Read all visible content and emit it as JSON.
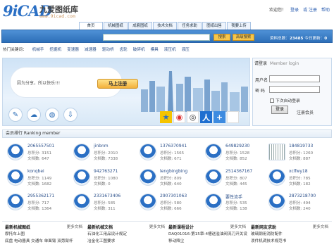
{
  "header": {
    "logo_mark": "9iCAD",
    "logo_name": "九爱图纸库",
    "logo_url": "www.9icad.com",
    "welcome": "欢迎您！",
    "login_link": "登录",
    "register_link": "或 注册",
    "help": "帮助"
  },
  "nav": {
    "tabs": [
      "首页",
      "机械图纸",
      "成套图纸",
      "技术文档",
      "任务求助",
      "图纸出售",
      "我要上传"
    ]
  },
  "search": {
    "search_button": "搜索",
    "advanced_button": "高级搜索",
    "stats_label": "资料总数：",
    "stats_value": "23485",
    "stats_sep": "今日更新：",
    "today_value": "0"
  },
  "hot": {
    "label": "热门关键词：",
    "keywords": [
      "机械手",
      "挖掘机",
      "变速器",
      "减速器",
      "驱动桥",
      "齿轮",
      "破碎机",
      "模具",
      "液压机",
      "液压"
    ]
  },
  "banner": {
    "slogan": "因为分享，所以快乐!!!",
    "register_button": "马上注册",
    "feature_icons": [
      "share-icon",
      "upload-icon",
      "globe-icon",
      "download-icon"
    ],
    "social_icons": [
      "star-icon",
      "weibo-icon",
      "qzone-icon",
      "people-icon",
      "plus-icon"
    ]
  },
  "login": {
    "title": "请登录",
    "subtitle": "Member login",
    "user_label": "用户名",
    "pass_label": "密  码",
    "remember": "下次自动登录",
    "login_button": "登录",
    "register_link": "注册会员"
  },
  "ranking": {
    "title": "会员排行 Ranking member",
    "members": [
      {
        "name": "2065557501",
        "score": "总积分: 3151",
        "docs": "文档数: 647"
      },
      {
        "name": "jinbnm",
        "score": "总积分: 2010",
        "docs": "文档数: 7338"
      },
      {
        "name": "1376370941",
        "score": "总积分: 1565",
        "docs": "文档数: 671"
      },
      {
        "name": "649829230",
        "score": "总积分: 1528",
        "docs": "文档数: 852"
      },
      {
        "name": "184819733",
        "score": "总积分: 1260",
        "docs": "文档数: 887"
      },
      {
        "name": "konqbei",
        "score": "总积分: 1149",
        "docs": "文档数: 1682"
      },
      {
        "name": "942763271",
        "score": "总积分: 1080",
        "docs": "文档数: 0"
      },
      {
        "name": "lengbingbing",
        "score": "总积分: 809",
        "docs": "文档数: 640"
      },
      {
        "name": "2514367167",
        "score": "总积分: 807",
        "docs": "文档数: 445"
      },
      {
        "name": "xclfwy18",
        "score": "总积分: 785",
        "docs": "文档数: 182"
      },
      {
        "name": "2955362171",
        "score": "总积分: 717",
        "docs": "文档数: 1364"
      },
      {
        "name": "2331673406",
        "score": "总积分: 585",
        "docs": "文档数: 311"
      },
      {
        "name": "2907301063",
        "score": "总积分: 580",
        "docs": "文档数: 666"
      },
      {
        "name": "要性流手",
        "score": "总积分: 535",
        "docs": "文档数: 138"
      },
      {
        "name": "2873218700",
        "score": "总积分: 494",
        "docs": "文档数: 240"
      }
    ]
  },
  "footer": {
    "more": "更多文档",
    "columns": [
      {
        "title": "最新机械图纸",
        "lines": [
          "摩托车上图",
          "底盘 电动器具 交通车 单面臂 双旁臂杆"
        ]
      },
      {
        "title": "最新机械文档",
        "lines": [
          "石油化工用品设计规定",
          "冶金化工图要求"
        ]
      },
      {
        "title": "最新课程设计",
        "lines": [
          "DAQ01016-第15章-4槽送溢油阀流刀开关设",
          "移动降尘"
        ]
      },
      {
        "title": "最新网友求助",
        "lines": [
          "玻璃钢用消防配件",
          "泼件机调技术规范书"
        ]
      }
    ]
  }
}
